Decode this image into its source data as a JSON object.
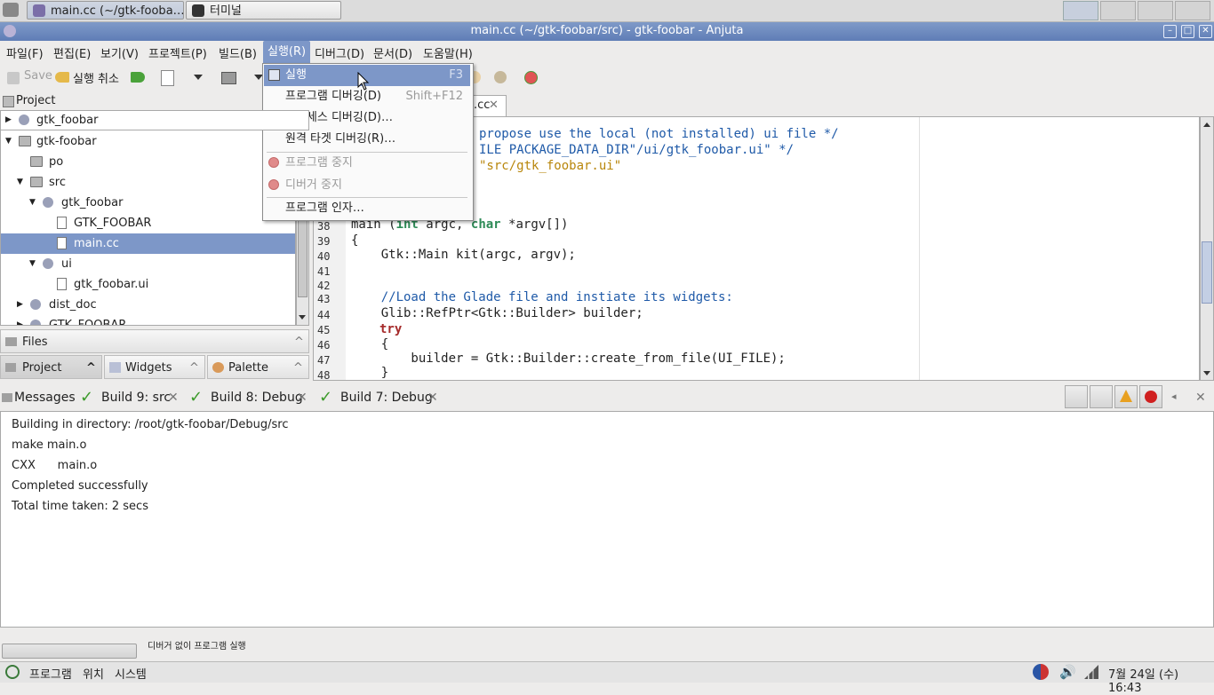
{
  "taskbar": {
    "tasks": [
      "main.cc (~/gtk-fooba…",
      "터미널"
    ]
  },
  "window": {
    "title": "main.cc (~/gtk-foobar/src) - gtk-foobar - Anjuta",
    "min": "–",
    "max": "□",
    "close": "✕"
  },
  "menubar": {
    "items": [
      "파일(F)",
      "편집(E)",
      "보기(V)",
      "프로젝트(P)",
      "빌드(B)",
      "실행(R)",
      "디버그(D)",
      "문서(D)",
      "도움말(H)"
    ]
  },
  "toolbar": {
    "save": "Save",
    "undo": "실행 취소"
  },
  "run_menu": {
    "items": [
      {
        "label": "실행",
        "shortcut": "F3"
      },
      {
        "label": "프로그램 디버깅(D)",
        "shortcut": "Shift+F12"
      },
      {
        "label": "프로세스 디버깅(D)…",
        "shortcut": ""
      },
      {
        "label": "원격 타겟 디버깅(R)…",
        "shortcut": ""
      },
      {
        "label": "프로그램 중지",
        "shortcut": ""
      },
      {
        "label": "디버거 중지",
        "shortcut": ""
      },
      {
        "label": "프로그램 인자…",
        "shortcut": ""
      }
    ]
  },
  "project_panel": {
    "header": "Project",
    "selector": "gtk_foobar",
    "tree": [
      "gtk-foobar",
      "po",
      "src",
      "gtk_foobar",
      "GTK_FOOBAR",
      "main.cc",
      "ui",
      "gtk_foobar.ui",
      "dist_doc",
      "GTK_FOOBAR"
    ],
    "files_label": "Files",
    "tabs": [
      "Project",
      "Widgets",
      "Palette"
    ]
  },
  "editor": {
    "tab_label": ".cc",
    "code": {
      "c1": "propose use the local (not installed) ui file */",
      "c2": "ILE PACKAGE_DATA_DIR\"/ui/gtk_foobar.ui\" */",
      "c3": "\"src/gtk_foobar.ui\""
    },
    "lines": {
      "n38": "38",
      "n39": "39",
      "n40": "40",
      "n41": "41",
      "n42": "42",
      "n43": "43",
      "n44": "44",
      "n45": "45",
      "n46": "46",
      "n47": "47",
      "n48": "48"
    },
    "l38": {
      "a": "main (",
      "b": "int",
      "c": " argc, ",
      "d": "char",
      "e": " *argv[])"
    },
    "l39": "{",
    "l40": "    Gtk::Main kit(argc, argv);",
    "l43": "    //Load the Glade file and instiate its widgets:",
    "l44": "    Glib::RefPtr<Gtk::Builder> builder;",
    "l45": "try",
    "l46": "    {",
    "l47": "        builder = Gtk::Builder::create_from_file(UI_FILE);",
    "l48": "    }"
  },
  "messages": {
    "tabs": [
      "Messages",
      "Build 9: src",
      "Build 8: Debug",
      "Build 7: Debug"
    ],
    "lines": [
      "Building in directory: /root/gtk-foobar/Debug/src",
      "make main.o",
      "CXX      main.o",
      "Completed successfully",
      "Total time taken: 2 secs"
    ]
  },
  "status": {
    "text": "디버거 없이 프로그램 실행"
  },
  "bottom_panel": {
    "menus": [
      "프로그램",
      "위치",
      "시스템"
    ],
    "clock": "7월 24일 (수) 16:43"
  }
}
